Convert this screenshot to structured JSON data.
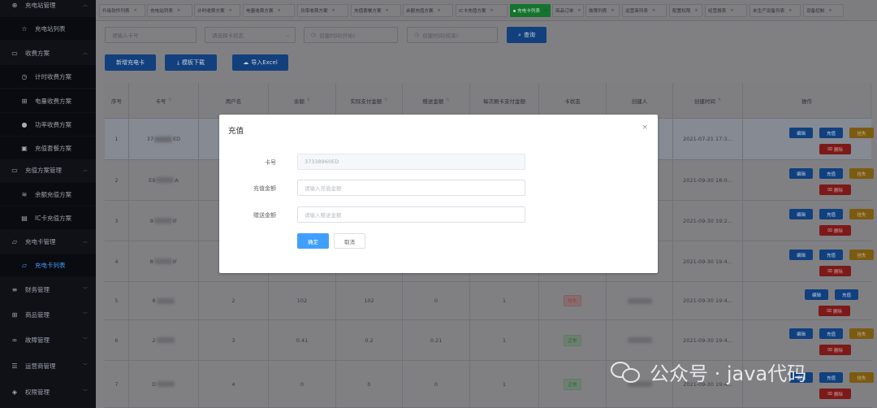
{
  "sidebar": {
    "items": [
      {
        "label": "充电站管理",
        "icon": "plus-circle-icon",
        "sub": false,
        "arrow": "up"
      },
      {
        "label": "充电站列表",
        "icon": "star-icon",
        "sub": true
      },
      {
        "label": "收费方案",
        "icon": "book-icon",
        "sub": false,
        "arrow": "up"
      },
      {
        "label": "计时收费方案",
        "icon": "clock-icon",
        "sub": true
      },
      {
        "label": "电量收费方案",
        "icon": "cart-icon",
        "sub": true
      },
      {
        "label": "功率收费方案",
        "icon": "bulb-icon",
        "sub": true
      },
      {
        "label": "充值套餐方案",
        "icon": "save-icon",
        "sub": true
      },
      {
        "label": "充值方案管理",
        "icon": "book-icon",
        "sub": false,
        "arrow": "up"
      },
      {
        "label": "余额充值方案",
        "icon": "coin-icon",
        "sub": true
      },
      {
        "label": "IC卡充值方案",
        "icon": "ic-card-icon",
        "sub": true
      },
      {
        "label": "充电卡管理",
        "icon": "folder-icon",
        "sub": false,
        "arrow": "up"
      },
      {
        "label": "充电卡列表",
        "icon": "folder-icon",
        "sub": true,
        "active": true
      },
      {
        "label": "财务管理",
        "icon": "database-icon",
        "sub": false,
        "arrow": "down"
      },
      {
        "label": "商品管理",
        "icon": "cart-icon",
        "sub": false,
        "arrow": "down"
      },
      {
        "label": "故障管理",
        "icon": "link-icon",
        "sub": false,
        "arrow": "down"
      },
      {
        "label": "运营商管理",
        "icon": "list-icon",
        "sub": false,
        "arrow": "down"
      },
      {
        "label": "权限管理",
        "icon": "shield-icon",
        "sub": false,
        "arrow": "down"
      }
    ]
  },
  "tags": [
    "升级软件列表",
    "充电站列表",
    "计时收费方案",
    "电量收费方案",
    "功率收费方案",
    "充值套餐方案",
    "余额充值方案",
    "IC卡充值方案",
    "充电卡列表",
    "商品订单",
    "故障列表",
    "运营商列表",
    "配置权限",
    "经营报表",
    "未生产设备列表",
    "设备控制"
  ],
  "active_tag": "充电卡列表",
  "filters": {
    "card_no_placeholder": "请输入卡号",
    "status_placeholder": "请选择卡状态",
    "start_placeholder": "创建时间(开始)",
    "end_placeholder": "创建时间(结束)",
    "query_label": "查询"
  },
  "toolbar": {
    "add_label": "新增充电卡",
    "template_label": "模板下载",
    "import_label": "导入Excel"
  },
  "table": {
    "headers": [
      "序号",
      "卡号",
      "用户名",
      "余额",
      "实际支付金额",
      "赠送金额",
      "每次刷卡支付金额",
      "卡状态",
      "创建人",
      "创建时间",
      "操作"
    ],
    "rows": [
      {
        "idx": "1",
        "card_pre": "37",
        "card_suf": "ED",
        "user": "",
        "balance": "",
        "paid": "",
        "gift": "",
        "per": "",
        "status": "",
        "time": "2021-07-21 17:3...",
        "actions": [
          "编辑",
          "充值",
          "挂失",
          "删除"
        ]
      },
      {
        "idx": "2",
        "card_pre": "E9",
        "card_suf": "A",
        "user": "",
        "balance": "",
        "paid": "",
        "gift": "",
        "per": "",
        "status": "",
        "time": "2021-09-30 18:0...",
        "actions": [
          "编辑",
          "充值",
          "挂失",
          "删除"
        ]
      },
      {
        "idx": "3",
        "card_pre": "9",
        "card_suf": "IF",
        "user": "",
        "balance": "",
        "paid": "",
        "gift": "",
        "per": "",
        "status": "",
        "time": "2021-09-30 19:2...",
        "actions": [
          "编辑",
          "充值",
          "挂失",
          "删除"
        ]
      },
      {
        "idx": "4",
        "card_pre": "8",
        "card_suf": "IF",
        "user": "",
        "balance": "",
        "paid": "",
        "gift": "",
        "per": "",
        "status": "",
        "time": "2021-09-30 19:4...",
        "actions": [
          "编辑",
          "充值",
          "挂失",
          "删除"
        ]
      },
      {
        "idx": "5",
        "card_pre": "8",
        "card_suf": "",
        "user": "2",
        "balance": "102",
        "paid": "102",
        "gift": "0",
        "per": "1",
        "status": "挂失",
        "time": "2021-09-30 19:4...",
        "actions": [
          "编辑",
          "充值",
          "删除"
        ]
      },
      {
        "idx": "6",
        "card_pre": "2",
        "card_suf": "",
        "user": "3",
        "balance": "0.41",
        "paid": "0.2",
        "gift": "0.21",
        "per": "1",
        "status": "正常",
        "time": "2021-09-30 19:4...",
        "actions": [
          "编辑",
          "充值",
          "挂失",
          "删除"
        ]
      },
      {
        "idx": "7",
        "card_pre": "D",
        "card_suf": "",
        "user": "4",
        "balance": "0",
        "paid": "0",
        "gift": "0",
        "per": "1",
        "status": "正常",
        "time": "2021-09-30 19:4...",
        "actions": [
          "编辑",
          "充值",
          "挂失",
          "删除"
        ]
      }
    ]
  },
  "modal": {
    "title": "充值",
    "card_label": "卡号",
    "card_value": "37338960ED",
    "amount_label": "充值金额",
    "amount_placeholder": "请输入充值金额",
    "gift_label": "赠送金额",
    "gift_placeholder": "请输入赠送金额",
    "confirm_label": "确定",
    "cancel_label": "取消",
    "close_glyph": "×"
  },
  "watermark": {
    "text": "公众号 · java代码"
  },
  "colors": {
    "primary": "#409eff",
    "success": "#67c23a",
    "warning": "#e6a23c",
    "danger": "#f56c6c",
    "sidebar": "#1f2230"
  }
}
